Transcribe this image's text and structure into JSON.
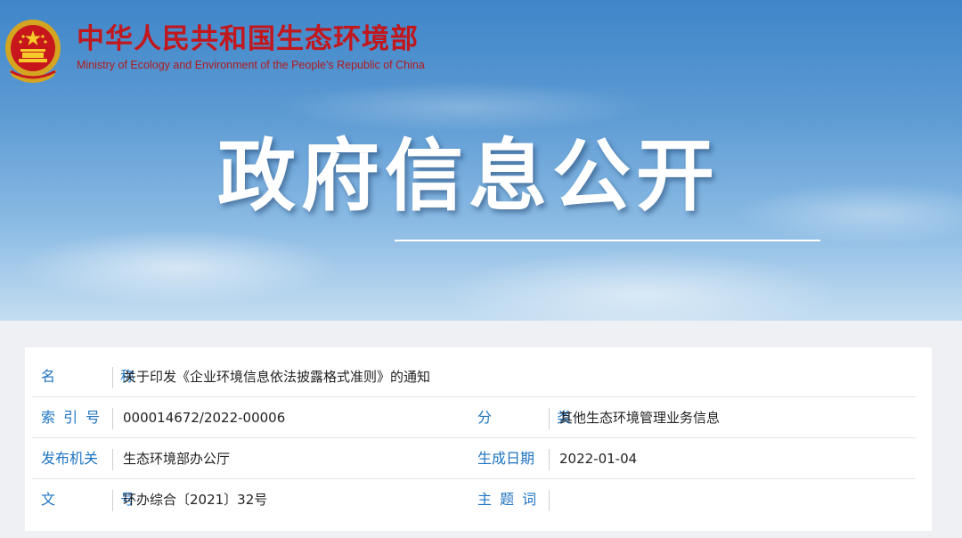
{
  "header": {
    "ministry_cn": "中华人民共和国生态环境部",
    "ministry_en": "Ministry of Ecology and Environment of the People's Republic of China",
    "emblem_icon": "national-emblem-icon"
  },
  "banner": {
    "title": "政府信息公开"
  },
  "info": {
    "name_label": "名 称",
    "name_value": "关于印发《企业环境信息依法披露格式准则》的通知",
    "index_label": "索 引 号",
    "index_value": "000014672/2022-00006",
    "category_label": "分 类",
    "category_value": "其他生态环境管理业务信息",
    "issuer_label": "发布机关",
    "issuer_value": "生态环境部办公厅",
    "date_label": "生成日期",
    "date_value": "2022-01-04",
    "docno_label": "文 号",
    "docno_value": "环办综合〔2021〕32号",
    "subject_label": "主 题 词",
    "subject_value": ""
  },
  "colors": {
    "brand_red": "#c1171d",
    "label_blue": "#1f74c2",
    "sky_blue": "#3f86c9"
  }
}
